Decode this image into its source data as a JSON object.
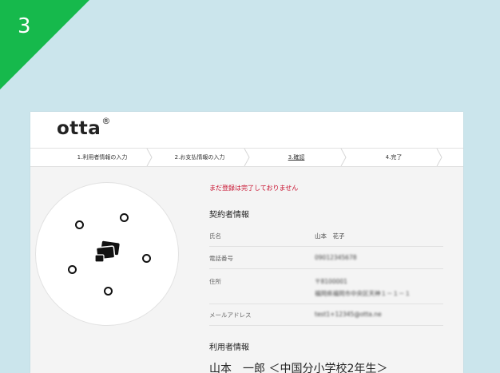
{
  "badge": {
    "number": "3",
    "color": "#16b94c"
  },
  "app": {
    "logo": "otta",
    "logo_mark": "®"
  },
  "steps": [
    {
      "label": "1.利用者情報の入力"
    },
    {
      "label": "2.お支払情報の入力"
    },
    {
      "label": "3.確認",
      "active": true
    },
    {
      "label": "4.完了"
    }
  ],
  "notice": "まだ登録は完了しておりません",
  "contract": {
    "title": "契約者情報",
    "rows": [
      {
        "label": "氏名",
        "value": "山本　花子"
      },
      {
        "label": "電話番号",
        "value": "09012345678"
      },
      {
        "label": "住所",
        "value": "〒8100001",
        "value2": "福岡県福岡市中央区天神１－１－１"
      },
      {
        "label": "メールアドレス",
        "value": "test1+12345@otta.ne"
      }
    ]
  },
  "user": {
    "title": "利用者情報",
    "name_line": "山本　一郎 ＜中国分小学校2年生＞"
  },
  "icons": [
    "ring-icon",
    "cards-icon"
  ]
}
